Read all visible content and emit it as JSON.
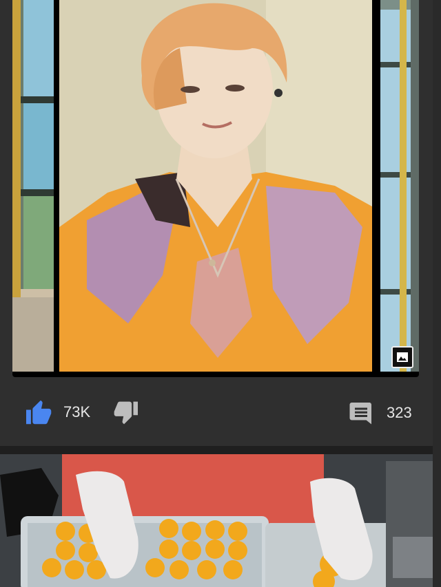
{
  "post": {
    "gallery_icon": "image-icon",
    "actions": {
      "like_icon": "thumbs-up-icon",
      "like_count": "73K",
      "dislike_icon": "thumbs-down-icon",
      "comment_icon": "comment-icon",
      "comment_count": "323"
    },
    "colors": {
      "like_active": "#4a86f0",
      "icon_muted": "#bdbdbd",
      "background": "#2f2f2f"
    }
  }
}
